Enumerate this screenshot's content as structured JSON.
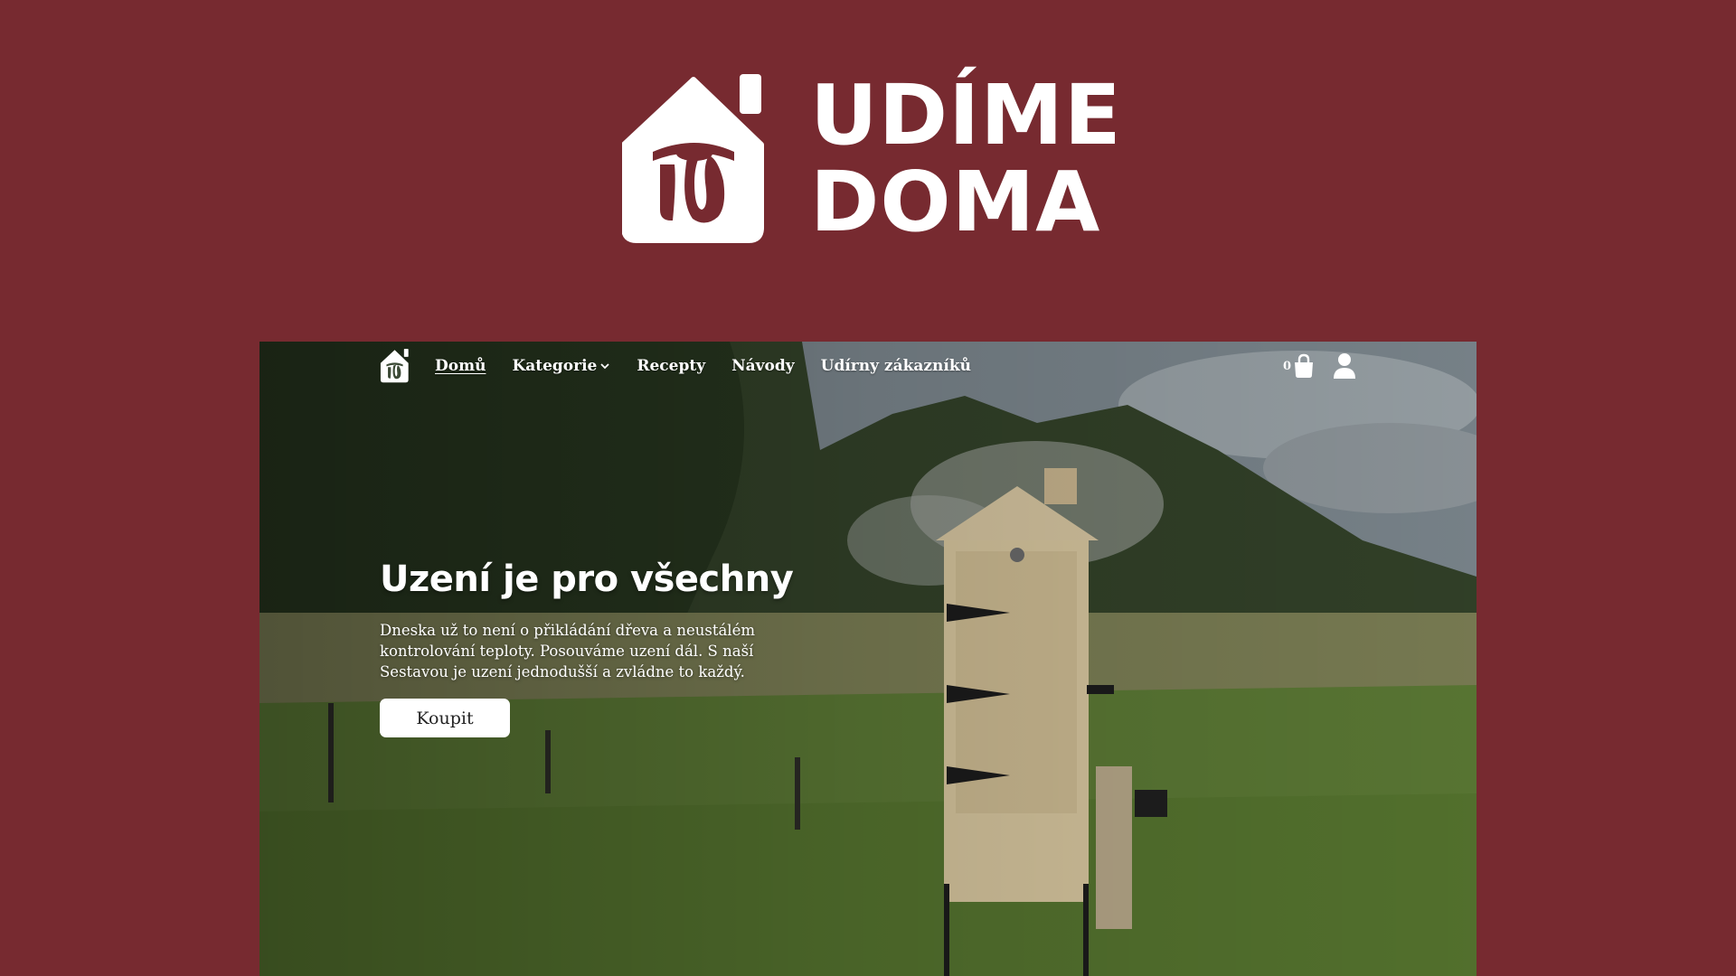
{
  "brand": {
    "wordmark_line1": "UDÍME",
    "wordmark_line2": "DOMA",
    "logo_icon": "smokehouse-house-icon",
    "background_color": "#772a30"
  },
  "nav": {
    "items": [
      {
        "label": "Domů",
        "active": true
      },
      {
        "label": "Kategorie",
        "has_dropdown": true
      },
      {
        "label": "Recepty"
      },
      {
        "label": "Návody"
      },
      {
        "label": "Udírny zákazníků"
      }
    ],
    "cart_count": "0",
    "cart_icon": "shopping-bag-icon",
    "user_icon": "user-icon"
  },
  "hero": {
    "title": "Uzení je pro všechny",
    "text": "Dneska už to není o přikládání dřeva a neustálém kontrolování teploty. Posouváme uzení dál. S naší Sestavou je uzení jednodušší a zvládne to každý.",
    "button_label": "Koupit",
    "background_image": "wooden-smokehouse-in-garden-photo"
  }
}
